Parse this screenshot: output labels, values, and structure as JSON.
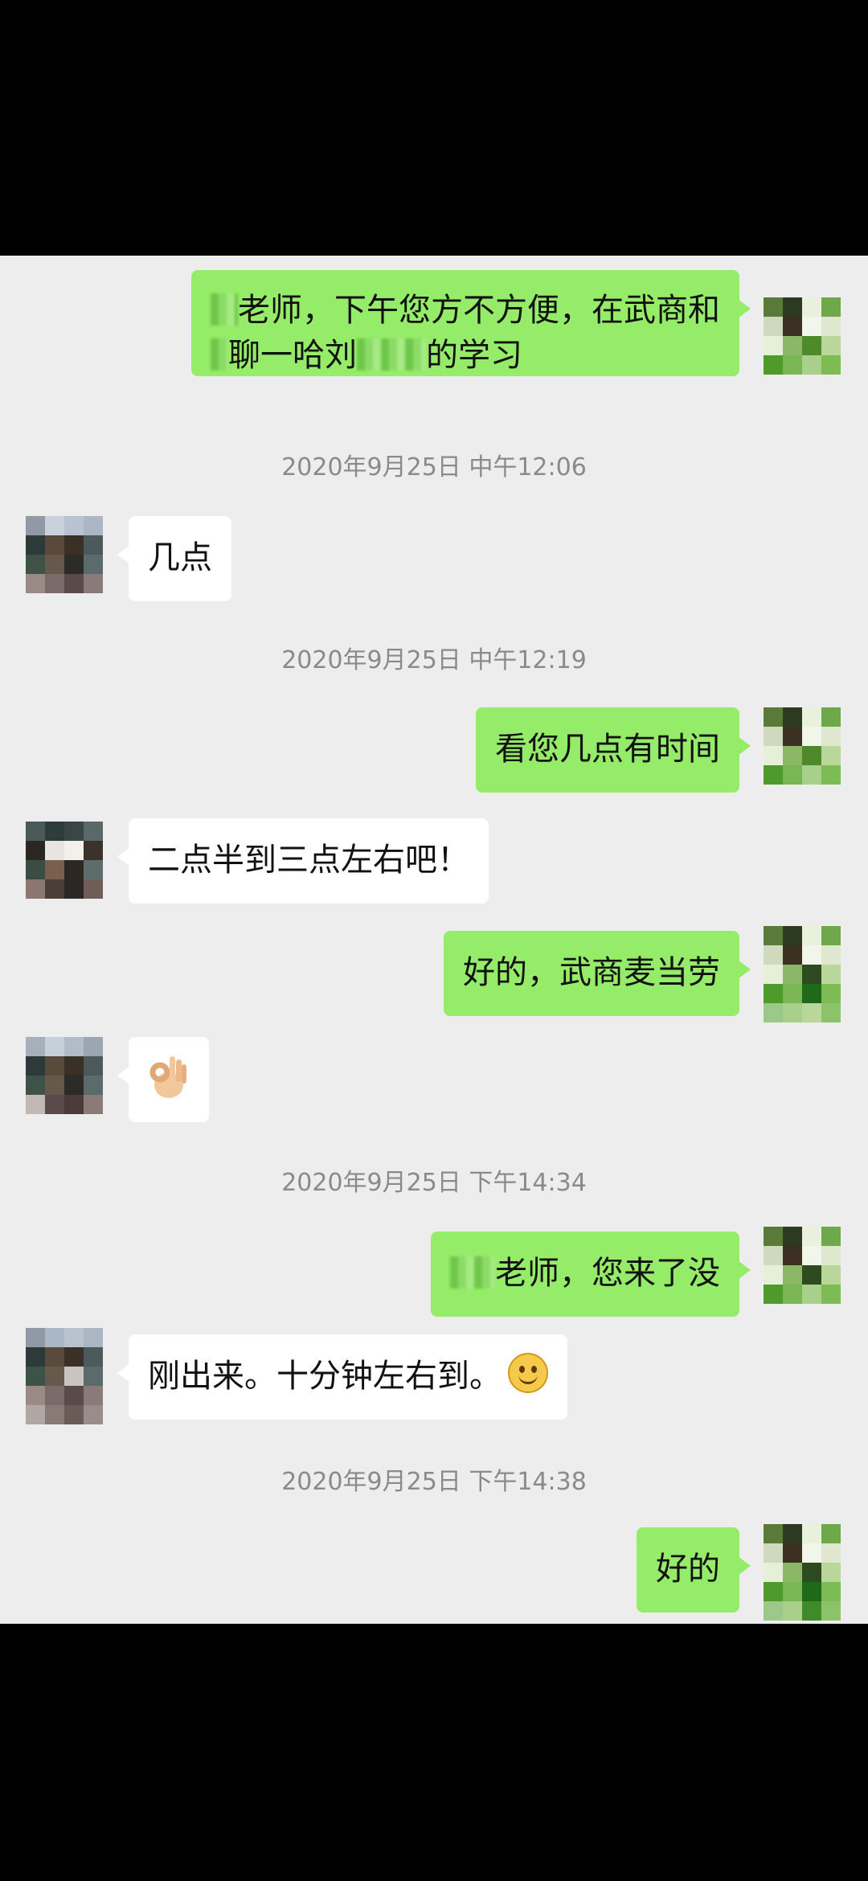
{
  "messages": [
    {
      "line1a": "老师，下午您方不方便，在武商和",
      "line2a": "聊一哈刘",
      "line2b": "的学习"
    },
    {
      "timestamp": "2020年9月25日 中午12:06"
    },
    {
      "text": "几点"
    },
    {
      "timestamp": "2020年9月25日 中午12:19"
    },
    {
      "text": "看您几点有时间"
    },
    {
      "text": "二点半到三点左右吧！"
    },
    {
      "text": "好的，武商麦当劳"
    },
    {
      "emoji": "ok-hand"
    },
    {
      "timestamp": "2020年9月25日 下午14:34"
    },
    {
      "text": "老师，您来了没"
    },
    {
      "text": "刚出来。十分钟左右到。",
      "emoji": "smile"
    },
    {
      "timestamp": "2020年9月25日 下午14:38"
    },
    {
      "text": "好的"
    }
  ],
  "colors": {
    "outgoing_bubble": "#95ec69",
    "incoming_bubble": "#ffffff",
    "chat_background": "#ededed",
    "timestamp_text": "#8a8a8a"
  }
}
